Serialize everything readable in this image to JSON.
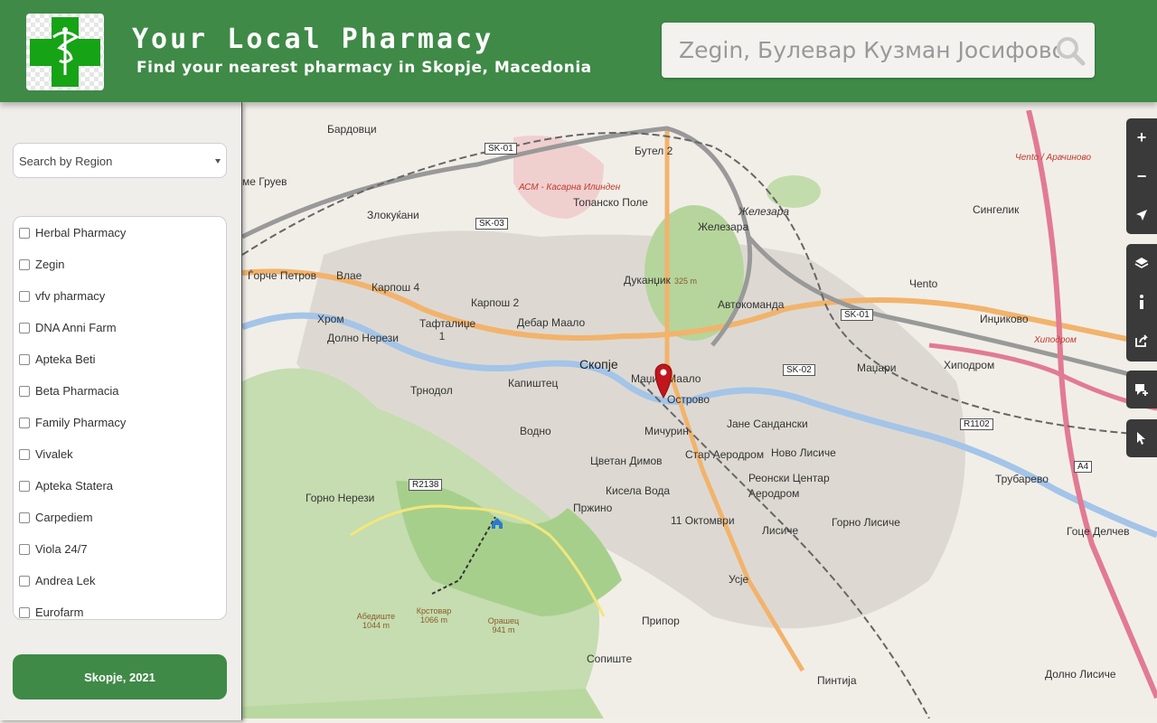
{
  "header": {
    "title": "Your Local Pharmacy",
    "subtitle": "Find your nearest pharmacy in Skopje, Macedonia",
    "search_value": "Zegin, Булевар Кузман Јосифовски Питу"
  },
  "sidebar": {
    "region_placeholder": "Search by Region",
    "pharmacies": [
      "Herbal Pharmacy",
      "Zegin",
      "vfv pharmacy",
      "DNA Anni Farm",
      "Apteka Beti",
      "Beta Pharmacia",
      "Family Pharmacy",
      "Vivalek",
      "Apteka Statera",
      "Carpediem",
      "Viola 24/7",
      "Andrea Lek",
      "Eurofarm"
    ],
    "footer_button": "Skopje, 2021"
  },
  "map": {
    "labels": {
      "bardovci": "Бардовци",
      "butel2": "Бутел 2",
      "asm": "АСМ - Касарна Илинден",
      "topansko": "Топанско Поле",
      "zhelezara": "Железара",
      "zhelezara2": "Железара",
      "singelik": "Сингелик",
      "chento1": "Чento / Арачиново",
      "chento": "Чento",
      "grueva": "ме Груев",
      "zlokukjani": "Злокуќани",
      "gorche": "Ѓорче Петров",
      "vlae": "Влае",
      "karposh4": "Карпош 4",
      "karposh2": "Карпош 2",
      "dukandzik": "Дуканџик",
      "peak325": "325 m",
      "avtokomanda": "Автокоманда",
      "hrom": "Хром",
      "dolno": "Долно Нерези",
      "taftalidze": "Тафталиџе 1",
      "debar": "Дебар Маало",
      "skopje": "Скопје",
      "inikovo": "Инџиково",
      "trnodol": "Трнодол",
      "kapishtec": "Капиштец",
      "madzir": "Маџир Маало",
      "ostrovo": "Острово",
      "madzari": "Маџари",
      "hipodrom": "Хиподром",
      "hipodrom_red": "Хиподром",
      "vodno": "Водно",
      "michurin": "Мичурин",
      "jane": "Јане Сандански",
      "star": "Стар Аеродром",
      "novo": "Ново Лисиче",
      "reonski": "Реонски Центар Аеродром",
      "cvetan": "Цветан Димов",
      "kisela": "Кисела Вода",
      "gorno_nerezi": "Горно Нерези",
      "przhino": "Пржино",
      "oktomvri": "11 Октомври",
      "lisiche": "Лисиче",
      "gorno_lisiche": "Горно Лисиче",
      "trubarevo": "Трубарево",
      "goce": "Гоце Делчев",
      "usje": "Усје",
      "pripor": "Припор",
      "sopishte": "Сопиште",
      "pintija": "Пинтија",
      "dolno_lisiche": "Долно Лисиче",
      "abedishte": "Абедиште 1044 m",
      "krstovar": "Крстовар 1066 m",
      "orashec": "Орашец 941 m"
    },
    "road_tags": [
      "SK-01",
      "SK-03",
      "SK-01",
      "SK-02",
      "R1102",
      "R2138",
      "A4"
    ]
  }
}
